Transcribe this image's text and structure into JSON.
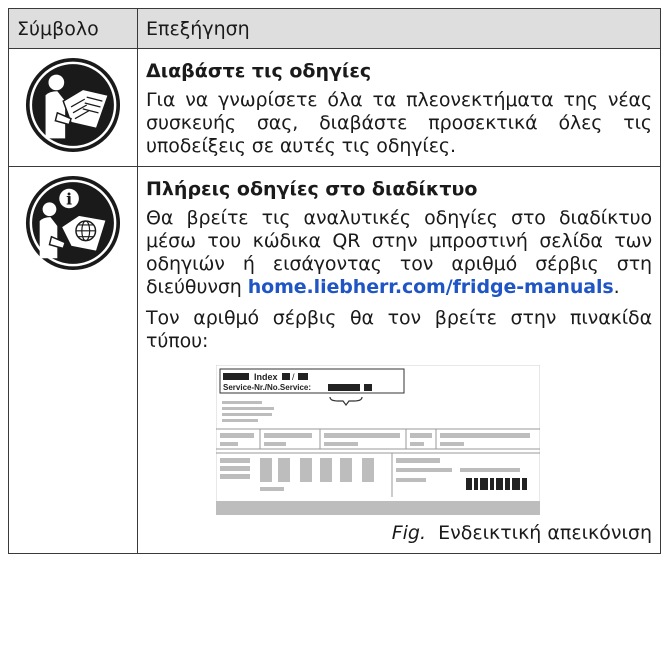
{
  "table": {
    "headers": [
      "Σύμβολο",
      "Επεξήγηση"
    ],
    "rows": [
      {
        "icon": "read-instructions-icon",
        "title": "Διαβάστε τις οδηγίες",
        "text": "Για να γνωρίσετε όλα τα πλεονεκτήματα της νέας συσκευής σας, διαβάστε προσεκτικά όλες τις υποδείξεις σε αυτές τις οδηγίες."
      },
      {
        "icon": "online-instructions-icon",
        "title": "Πλήρεις οδηγίες στο διαδίκτυο",
        "text_before_link": "Θα βρείτε τις αναλυτικές οδηγίες στο διαδί­κτυο μέσω του κώδικα QR στην μπροστινή σελίδα των οδηγιών ή εισάγοντας τον αριθμό σέρβις στη διεύθυνση ",
        "link": "home.liebherr.com/fridge-manuals",
        "text_after_link": ".",
        "text2": "Τον αριθμό σέρβις θα τον βρείτε στην πινα­κίδα τύπου:",
        "plate": {
          "line1": "Index",
          "line2": "Service-Nr./No.Service:"
        },
        "caption_prefix": "Fig.",
        "caption": "Ενδεικτική απεικόνιση"
      }
    ]
  }
}
